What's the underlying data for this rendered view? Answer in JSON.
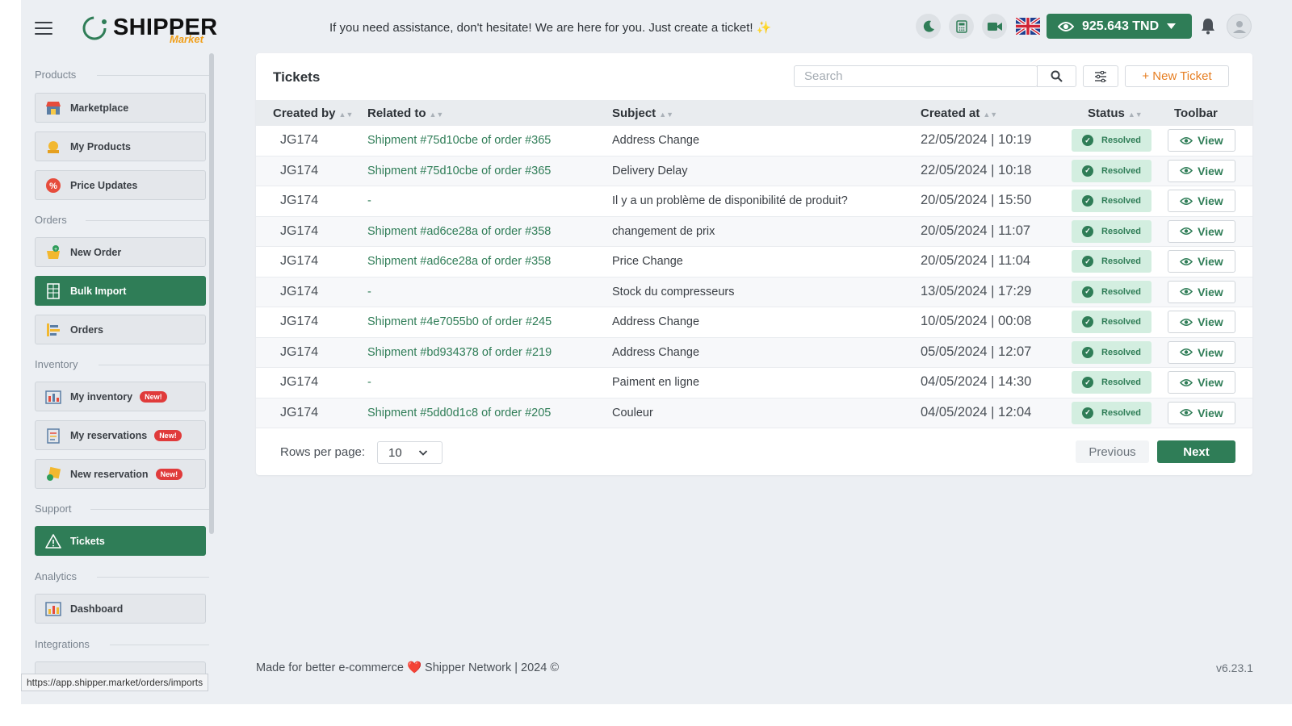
{
  "header": {
    "logo_text": "SHIPPER",
    "logo_sub": "Market",
    "message": "If you need assistance, don't hesitate! We are here for you. Just create a ticket! ✨",
    "balance": "925.643 TND"
  },
  "sidebar": {
    "sections": {
      "products": "Products",
      "orders": "Orders",
      "inventory": "Inventory",
      "support": "Support",
      "analytics": "Analytics",
      "integrations": "Integrations"
    },
    "items": {
      "marketplace": "Marketplace",
      "my_products": "My Products",
      "price_updates": "Price Updates",
      "new_order": "New Order",
      "bulk_import": "Bulk Import",
      "orders": "Orders",
      "my_inventory": "My inventory",
      "my_reservations": "My reservations",
      "new_reservation": "New reservation",
      "tickets": "Tickets",
      "dashboard": "Dashboard"
    },
    "new_badge": "New!"
  },
  "tickets": {
    "title": "Tickets",
    "search_placeholder": "Search",
    "new_ticket": "+ New Ticket",
    "columns": {
      "created_by": "Created by",
      "related_to": "Related to",
      "subject": "Subject",
      "created_at": "Created at",
      "status": "Status",
      "toolbar": "Toolbar"
    },
    "rows": [
      {
        "by": "JG174",
        "related": "Shipment #75d10cbe of order #365",
        "subject": "Address Change",
        "date": "22/05/2024 | 10:19",
        "status": "Resolved",
        "action": "View"
      },
      {
        "by": "JG174",
        "related": "Shipment #75d10cbe of order #365",
        "subject": "Delivery Delay",
        "date": "22/05/2024 | 10:18",
        "status": "Resolved",
        "action": "View"
      },
      {
        "by": "JG174",
        "related": "-",
        "subject": "Il y a un problème de disponibilité de produit?",
        "date": "20/05/2024 | 15:50",
        "status": "Resolved",
        "action": "View"
      },
      {
        "by": "JG174",
        "related": "Shipment #ad6ce28a of order #358",
        "subject": "changement de prix",
        "date": "20/05/2024 | 11:07",
        "status": "Resolved",
        "action": "View"
      },
      {
        "by": "JG174",
        "related": "Shipment #ad6ce28a of order #358",
        "subject": "Price Change",
        "date": "20/05/2024 | 11:04",
        "status": "Resolved",
        "action": "View"
      },
      {
        "by": "JG174",
        "related": "-",
        "subject": "Stock du compresseurs",
        "date": "13/05/2024 | 17:29",
        "status": "Resolved",
        "action": "View"
      },
      {
        "by": "JG174",
        "related": "Shipment #4e7055b0 of order #245",
        "subject": "Address Change",
        "date": "10/05/2024 | 00:08",
        "status": "Resolved",
        "action": "View"
      },
      {
        "by": "JG174",
        "related": "Shipment #bd934378 of order #219",
        "subject": "Address Change",
        "date": "05/05/2024 | 12:07",
        "status": "Resolved",
        "action": "View"
      },
      {
        "by": "JG174",
        "related": "-",
        "subject": "Paiment en ligne",
        "date": "04/05/2024 | 14:30",
        "status": "Resolved",
        "action": "View"
      },
      {
        "by": "JG174",
        "related": "Shipment #5dd0d1c8 of order #205",
        "subject": "Couleur",
        "date": "04/05/2024 | 12:04",
        "status": "Resolved",
        "action": "View"
      }
    ],
    "rows_per_page_label": "Rows per page:",
    "rows_per_page_value": "10",
    "previous": "Previous",
    "next": "Next"
  },
  "footer": {
    "text": "Made for better e-commerce ❤️ Shipper Network | 2024 ©",
    "version": "v6.23.1"
  },
  "status_url": "https://app.shipper.market/orders/imports",
  "colors": {
    "primary": "#2f7d57",
    "accent": "#e67e22",
    "badge": "#e03b3b"
  }
}
